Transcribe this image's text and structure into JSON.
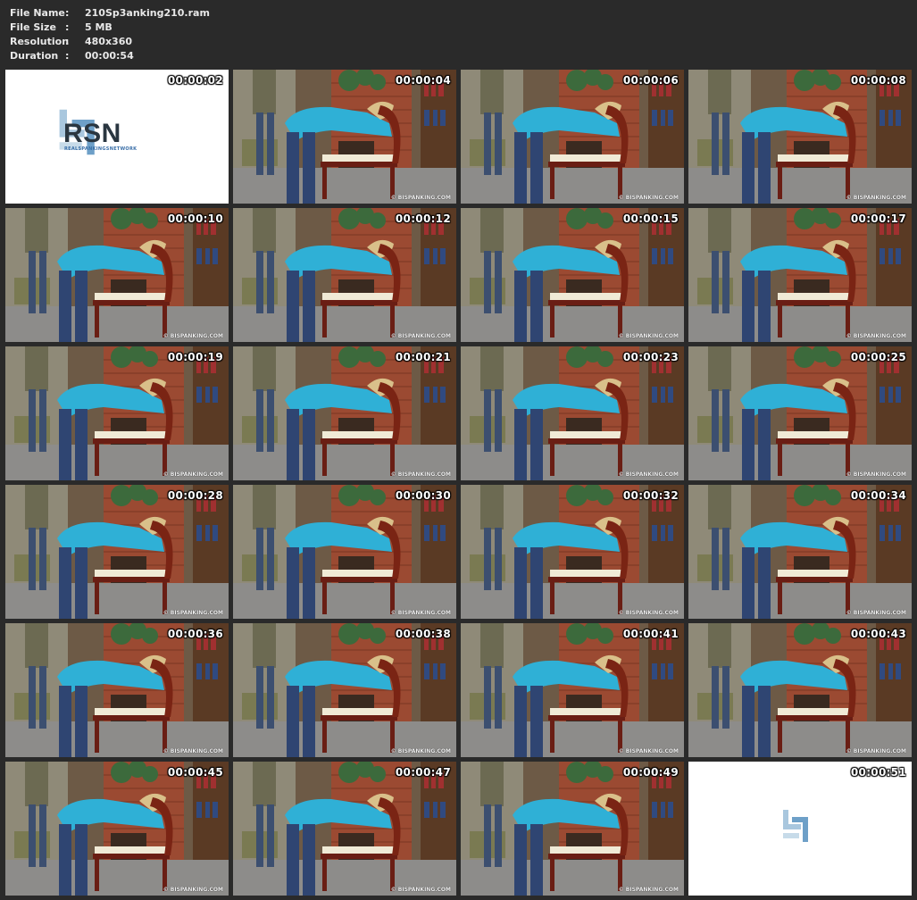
{
  "info": [
    {
      "label": "File Name",
      "value": "210Sp3anking210.ram"
    },
    {
      "label": "File Size",
      "value": "5 MB"
    },
    {
      "label": "Resolution",
      "value": "480x360"
    },
    {
      "label": "Duration",
      "value": "00:00:54"
    }
  ],
  "separator": ":",
  "watermark": "© BISPANKING.COM",
  "logo": {
    "text": "RSN",
    "subtitle": "REALSPANKINGSNETWORK"
  },
  "frames": [
    {
      "time": "00:00:02",
      "kind": "logo"
    },
    {
      "time": "00:00:04",
      "kind": "scene"
    },
    {
      "time": "00:00:06",
      "kind": "scene"
    },
    {
      "time": "00:00:08",
      "kind": "scene"
    },
    {
      "time": "00:00:10",
      "kind": "scene"
    },
    {
      "time": "00:00:12",
      "kind": "scene"
    },
    {
      "time": "00:00:15",
      "kind": "scene"
    },
    {
      "time": "00:00:17",
      "kind": "scene"
    },
    {
      "time": "00:00:19",
      "kind": "scene"
    },
    {
      "time": "00:00:21",
      "kind": "scene"
    },
    {
      "time": "00:00:23",
      "kind": "scene"
    },
    {
      "time": "00:00:25",
      "kind": "scene"
    },
    {
      "time": "00:00:28",
      "kind": "scene"
    },
    {
      "time": "00:00:30",
      "kind": "scene"
    },
    {
      "time": "00:00:32",
      "kind": "scene"
    },
    {
      "time": "00:00:34",
      "kind": "scene"
    },
    {
      "time": "00:00:36",
      "kind": "scene"
    },
    {
      "time": "00:00:38",
      "kind": "scene"
    },
    {
      "time": "00:00:41",
      "kind": "scene"
    },
    {
      "time": "00:00:43",
      "kind": "scene"
    },
    {
      "time": "00:00:45",
      "kind": "scene"
    },
    {
      "time": "00:00:47",
      "kind": "scene"
    },
    {
      "time": "00:00:49",
      "kind": "scene"
    },
    {
      "time": "00:00:51",
      "kind": "logo-small"
    }
  ]
}
